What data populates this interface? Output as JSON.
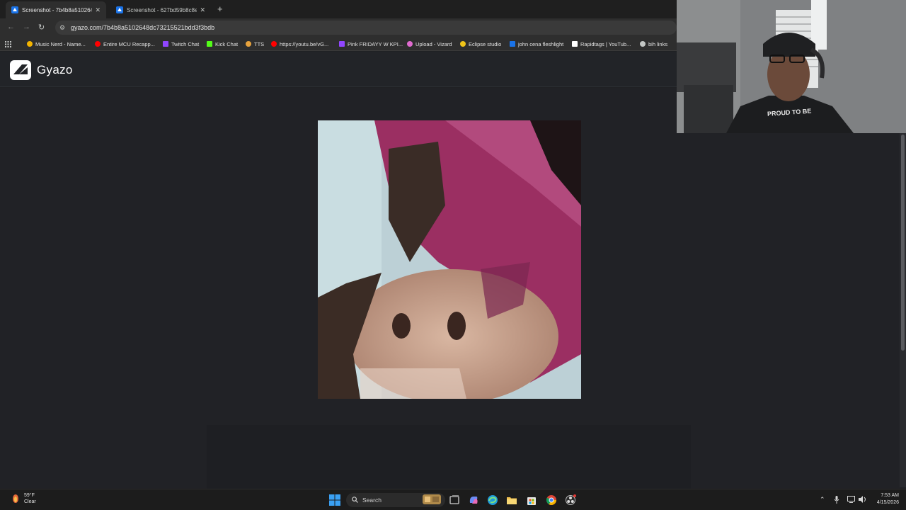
{
  "browser": {
    "tabs": [
      {
        "title": "Screenshot - 7b4b8a5102648d",
        "active": true
      },
      {
        "title": "Screenshot - 627bd59b8c8e27",
        "active": false
      }
    ],
    "new_tab_label": "+",
    "url": "gyazo.com/7b4b8a5102648dc73215521bdd3f3bdb",
    "bookmarks": [
      {
        "label": "Music Nerd - Name..."
      },
      {
        "label": "Entire MCU Recapp..."
      },
      {
        "label": "Twitch Chat"
      },
      {
        "label": "Kick Chat"
      },
      {
        "label": "TTS"
      },
      {
        "label": "https://youtu.be/vG..."
      },
      {
        "label": "Pink FRIDAYY W KPI..."
      },
      {
        "label": "Upload - Vizard"
      },
      {
        "label": "Eclipse studio"
      },
      {
        "label": "john cena fleshlight"
      },
      {
        "label": "Rapidtags | YouTub..."
      },
      {
        "label": "bih links"
      }
    ]
  },
  "gyazo": {
    "brand": "Gyazo"
  },
  "taskbar": {
    "weather_temp": "59°F",
    "weather_desc": "Clear",
    "search_label": "Search",
    "time": "7:53 AM",
    "date": "4/15/2026"
  },
  "colors": {
    "page_bg": "#212226",
    "chrome_bg": "#2e2e2e",
    "accent_tab": "#2e2e2e"
  }
}
